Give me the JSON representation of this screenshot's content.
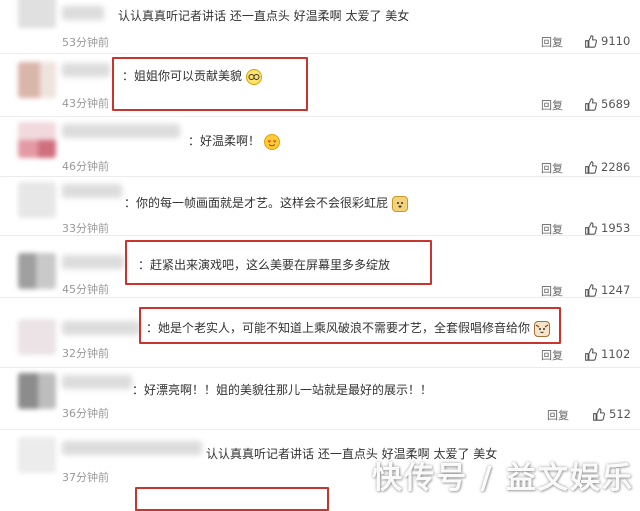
{
  "reply_label": "回复",
  "comments": [
    {
      "text": "认认真真听记者讲话 还一直点头 好温柔啊 太爱了 美女",
      "time": "53分钟前",
      "likes": "9110"
    },
    {
      "text": "：姐姐你可以贡献美貌",
      "time": "43分钟前",
      "likes": "5689",
      "emoji": "glasses-emoji"
    },
    {
      "text": "：好温柔啊！",
      "time": "46分钟前",
      "likes": "2286",
      "emoji": "heart-eyes-emoji"
    },
    {
      "text": "：你的每一帧画面就是才艺。这样会不会很彩虹屁",
      "time": "33分钟前",
      "likes": "1953",
      "emoji": "doge-emoji"
    },
    {
      "text": "：赶紧出来演戏吧，这么美要在屏幕里多多绽放",
      "time": "45分钟前",
      "likes": "1247"
    },
    {
      "text": "：她是个老实人，可能不知道上乘风破浪不需要才艺，全套假唱修音给你",
      "time": "32分钟前",
      "likes": "1102",
      "emoji": "cat-emoji"
    },
    {
      "text": "：好漂亮啊！！姐的美貌往那儿一站就是最好的展示！！",
      "time": "36分钟前",
      "likes": "512"
    },
    {
      "text": "认认真真听记者讲话 还一直点头 好温柔啊 太爱了 美女",
      "time": "37分钟前",
      "likes": ""
    }
  ],
  "watermark": "快传号 / 益文娱乐",
  "highlight_color": "#c8352e"
}
